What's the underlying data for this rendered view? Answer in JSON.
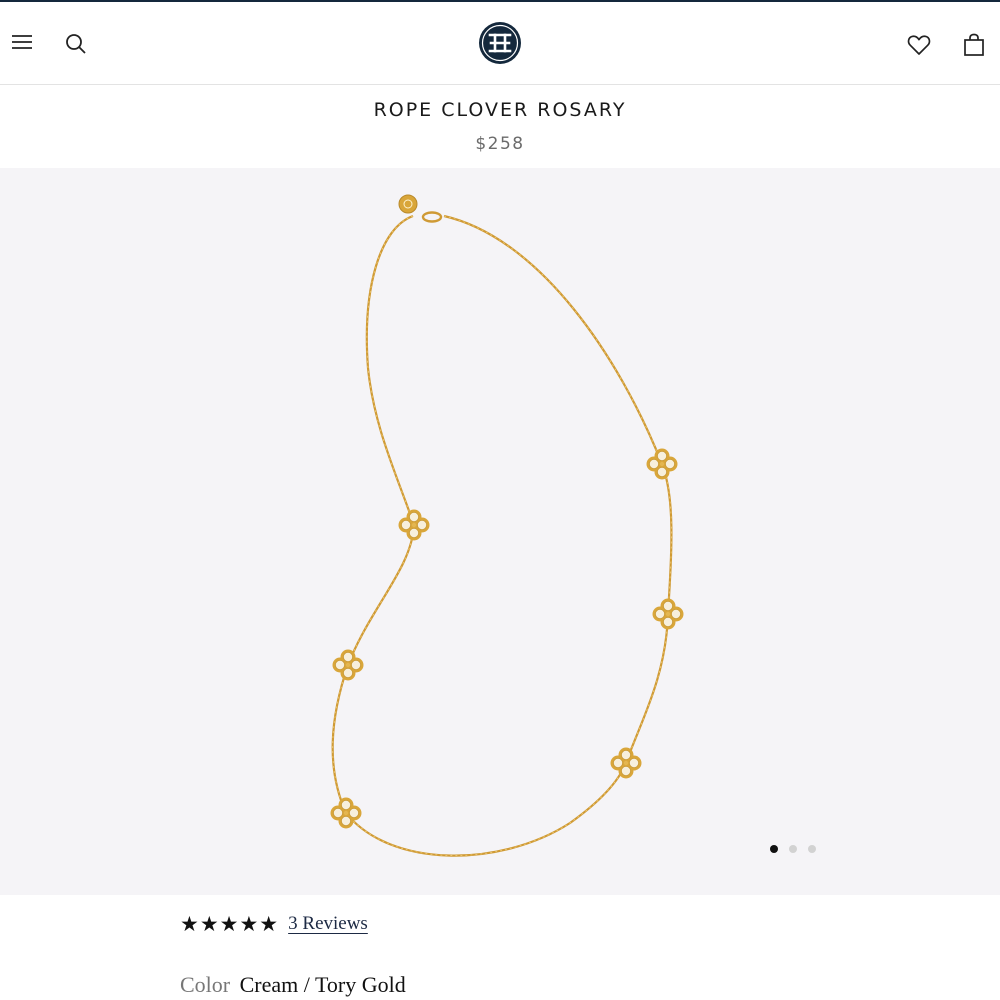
{
  "header": {
    "menu_icon": "hamburger-menu-icon",
    "search_icon": "search-icon",
    "logo": "tory-burch-logo",
    "wishlist_icon": "heart-icon",
    "bag_icon": "shopping-bag-icon"
  },
  "product": {
    "title": "ROPE CLOVER ROSARY",
    "price": "$258"
  },
  "gallery": {
    "image": "gold-necklace-with-pearl-clover-stations",
    "image_count": 3,
    "active_index": 0
  },
  "reviews": {
    "stars": "★★★★★",
    "rating": 5,
    "link_text": "3 Reviews"
  },
  "color": {
    "label": "Color",
    "value": "Cream / Tory Gold"
  },
  "colors": {
    "brand_navy": "#14283c",
    "gallery_bg": "#f5f4f7",
    "gold": "#d9a63a",
    "pearl": "#f7efdc"
  }
}
